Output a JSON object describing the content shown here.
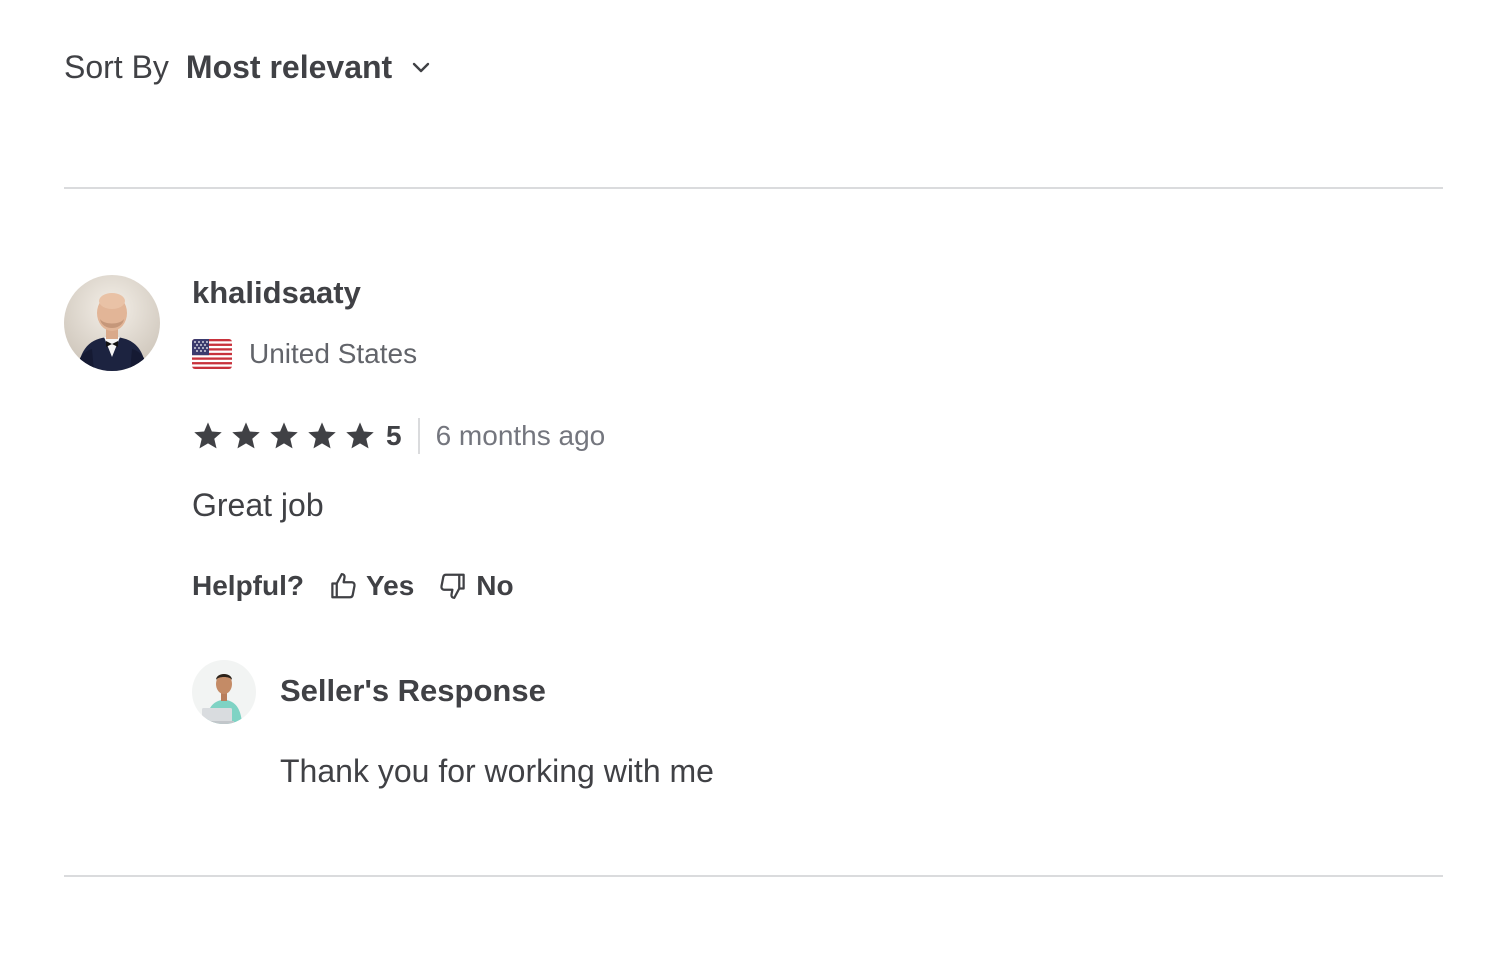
{
  "sort": {
    "label": "Sort By",
    "value": "Most relevant",
    "icon": "chevron-down-icon"
  },
  "review": {
    "reviewer_name": "khalidsaaty",
    "country": "United States",
    "country_flag_icon": "us-flag-icon",
    "rating": "5",
    "stars_filled": 5,
    "stars_total": 5,
    "time_ago": "6 months ago",
    "text": "Great job",
    "helpful": {
      "label": "Helpful?",
      "yes_label": "Yes",
      "no_label": "No",
      "yes_icon": "thumbs-up-icon",
      "no_icon": "thumbs-down-icon"
    },
    "seller_response": {
      "title": "Seller's Response",
      "text": "Thank you for working with me"
    }
  },
  "colors": {
    "text_primary": "#404145",
    "text_secondary": "#62646a",
    "text_muted": "#74767e",
    "divider": "#dadbdd",
    "star": "#404145"
  }
}
